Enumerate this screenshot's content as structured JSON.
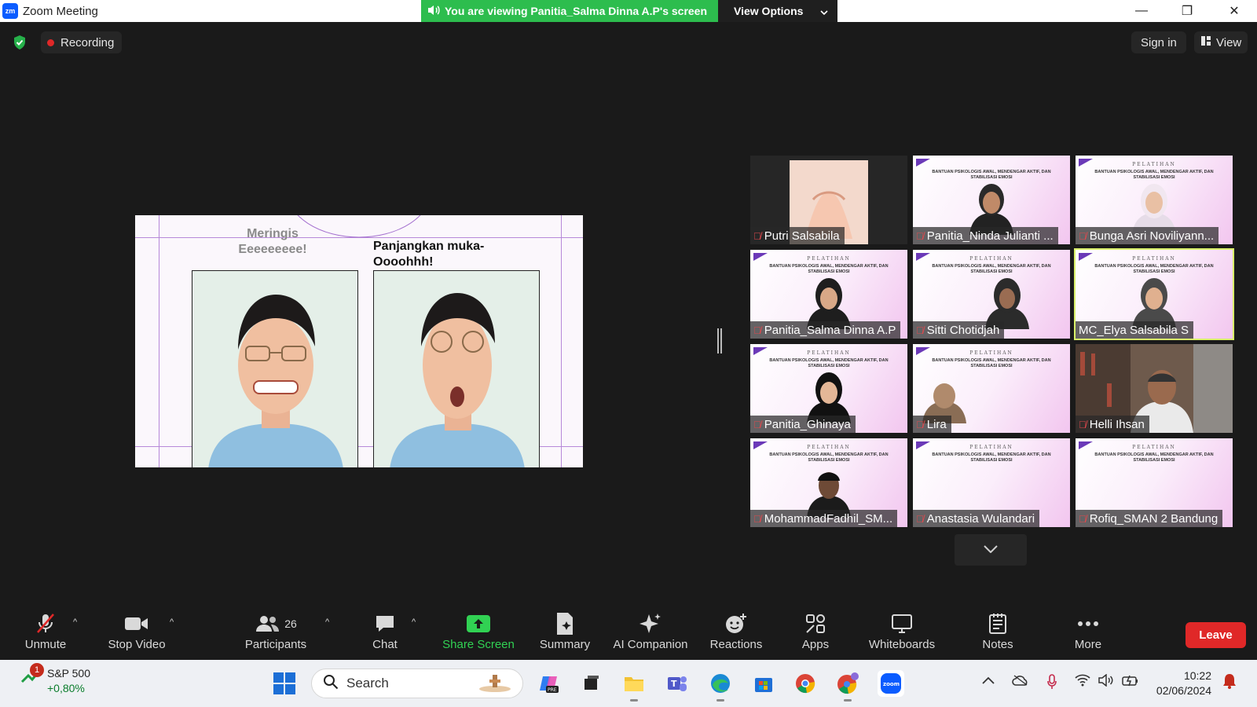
{
  "window": {
    "title": "Zoom Meeting",
    "logo_text": "zm",
    "viewing_banner": "You are viewing Panitia_Salma Dinna A.P's screen",
    "view_options_label": "View Options",
    "minimize": "—",
    "restore": "❐",
    "close": "✕"
  },
  "topbar": {
    "recording_label": "Recording",
    "sign_in_label": "Sign in",
    "view_label": "View"
  },
  "shared_screen": {
    "caption_left_line1": "Meringis",
    "caption_left_line2": "Eeeeeeeee!",
    "caption_right_line1": "Panjangkan muka-",
    "caption_right_line2": "Oooohhh!"
  },
  "slide_thumb": {
    "title": "PELATIHAN",
    "subtitle": "BANTUAN PSIKOLOGIS AWAL, MENDENGAR AKTIF, DAN STABILISASI EMOSI"
  },
  "participants": [
    {
      "name": "Putri Salsabila",
      "muted": true
    },
    {
      "name": "Panitia_Ninda Julianti ...",
      "muted": true
    },
    {
      "name": "Bunga Asri Noviliyann...",
      "muted": true
    },
    {
      "name": "Panitia_Salma Dinna A.P",
      "muted": true
    },
    {
      "name": "Sitti Chotidjah",
      "muted": true
    },
    {
      "name": "MC_Elya Salsabila S",
      "muted": false
    },
    {
      "name": "Panitia_Ghinaya",
      "muted": true
    },
    {
      "name": "Lira",
      "muted": true
    },
    {
      "name": "Helli Ihsan",
      "muted": true
    },
    {
      "name": "MohammadFadhil_SM...",
      "muted": true
    },
    {
      "name": "Anastasia Wulandari",
      "muted": true
    },
    {
      "name": "Rofiq_SMAN 2 Bandung",
      "muted": true
    }
  ],
  "toolbar": {
    "unmute": "Unmute",
    "stop_video": "Stop Video",
    "participants": "Participants",
    "participants_count": "26",
    "chat": "Chat",
    "share_screen": "Share Screen",
    "summary": "Summary",
    "ai_companion": "AI Companion",
    "reactions": "Reactions",
    "apps": "Apps",
    "whiteboards": "Whiteboards",
    "notes": "Notes",
    "more": "More",
    "leave": "Leave"
  },
  "taskbar": {
    "stock_name": "S&P 500",
    "stock_change": "+0,80%",
    "stock_badge": "1",
    "search_placeholder": "Search",
    "time": "10:22",
    "date": "02/06/2024"
  },
  "colors": {
    "zoom_blue": "#0b5cff",
    "banner_green": "#2dbd4e",
    "share_green": "#31d153",
    "leave_red": "#e02828",
    "active_speaker": "#d9f06a"
  }
}
